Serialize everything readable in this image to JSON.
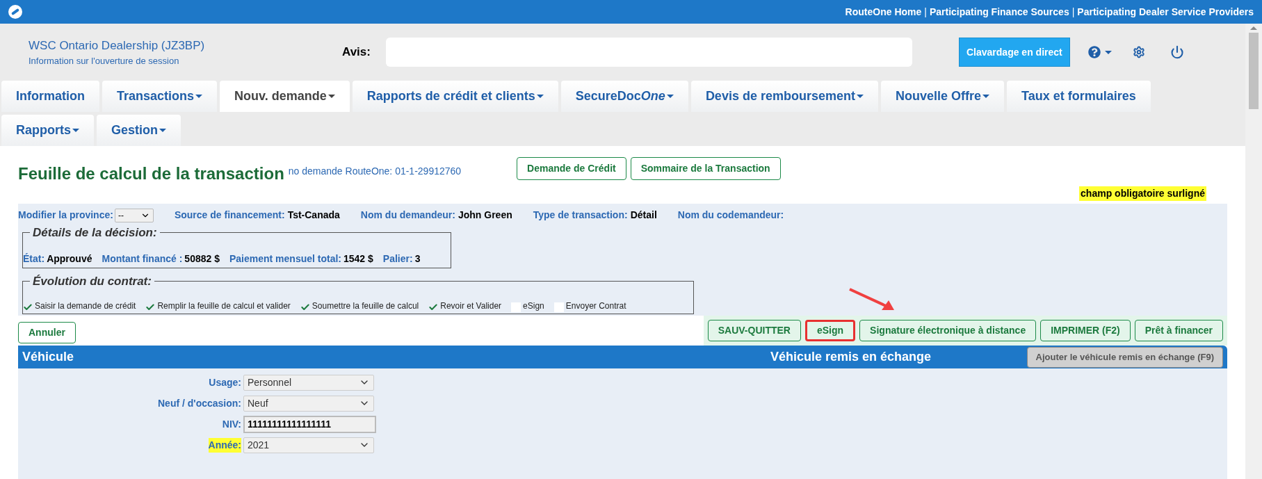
{
  "top_bar": {
    "links": [
      "RouteOne Home",
      "Participating Finance Sources",
      "Participating Dealer Service Providers"
    ],
    "separator": "|"
  },
  "header": {
    "dealer": "WSC Ontario Dealership (JZ3BP)",
    "session_info": "Information sur l'ouverture de session",
    "notice_label": "Avis:",
    "chat_button": "Clavardage en direct"
  },
  "tabs": [
    {
      "label": "Information",
      "dropdown": false,
      "selected": false
    },
    {
      "label": "Transactions",
      "dropdown": true,
      "selected": false
    },
    {
      "label": "Nouv. demande",
      "dropdown": true,
      "selected": true
    },
    {
      "label": "Rapports de crédit et clients",
      "dropdown": true,
      "selected": false
    },
    {
      "label": "SecureDoc",
      "italic_suffix": "One",
      "dropdown": true,
      "selected": false
    },
    {
      "label": "Devis de remboursement",
      "dropdown": true,
      "selected": false
    },
    {
      "label": "Nouvelle Offre",
      "dropdown": true,
      "selected": false
    },
    {
      "label": "Taux et formulaires",
      "dropdown": false,
      "selected": false
    },
    {
      "label": "Rapports",
      "dropdown": true,
      "selected": false
    },
    {
      "label": "Gestion",
      "dropdown": true,
      "selected": false
    }
  ],
  "page": {
    "title": "Feuille de calcul de la transaction",
    "request_number": "no demande RouteOne: 01-1-29912760",
    "nav_buttons": [
      "Demande de Crédit",
      "Sommaire de la Transaction"
    ],
    "required_note": "champ obligatoire surligné"
  },
  "summary": {
    "province_label": "Modifier la province:",
    "province_value": "--",
    "fields": [
      {
        "label": "Source de financement:",
        "value": "Tst-Canada"
      },
      {
        "label": "Nom du demandeur:",
        "value": "John Green"
      },
      {
        "label": "Type de transaction:",
        "value": "Détail"
      },
      {
        "label": "Nom du codemandeur:"
      }
    ]
  },
  "decision": {
    "legend": "Détails de la décision:",
    "fields": [
      {
        "label": "État:",
        "value": "Approuvé"
      },
      {
        "label": "Montant financé :",
        "value": "50882 $"
      },
      {
        "label": "Paiement mensuel total:",
        "value": "1542 $"
      },
      {
        "label": "Palier:",
        "value": "3"
      }
    ]
  },
  "progress": {
    "legend": "Évolution du contrat:",
    "steps": [
      {
        "label": "Saisir la demande de crédit",
        "checked": true
      },
      {
        "label": "Remplir la feuille de calcul et valider",
        "checked": true
      },
      {
        "label": "Soumettre la feuille de calcul",
        "checked": true
      },
      {
        "label": "Revoir et Valider",
        "checked": true
      },
      {
        "label": "eSign",
        "checked": false
      },
      {
        "label": "Envoyer Contrat",
        "checked": false
      }
    ]
  },
  "cancel_button": "Annuler",
  "action_buttons": [
    {
      "label": "SAUV-QUITTER",
      "highlighted": false
    },
    {
      "label": "eSign",
      "highlighted": true
    },
    {
      "label": "Signature électronique à distance",
      "highlighted": false
    },
    {
      "label": "IMPRIMER (F2)",
      "highlighted": false
    },
    {
      "label": "Prêt à financer",
      "highlighted": false
    }
  ],
  "vehicle": {
    "title": "Véhicule",
    "trade_in_title": "Véhicule remis en échange",
    "trade_in_button": "Ajouter le véhicule remis en échange (F9)",
    "fields": [
      {
        "kind": "select",
        "label": "Usage:",
        "value": "Personnel",
        "required": false
      },
      {
        "kind": "select",
        "label": "Neuf / d'occasion:",
        "value": "Neuf",
        "required": false
      },
      {
        "kind": "input",
        "label": "NIV:",
        "value": "11111111111111111",
        "required": false
      },
      {
        "kind": "select",
        "label": "Année:",
        "value": "2021",
        "required": true
      }
    ]
  }
}
